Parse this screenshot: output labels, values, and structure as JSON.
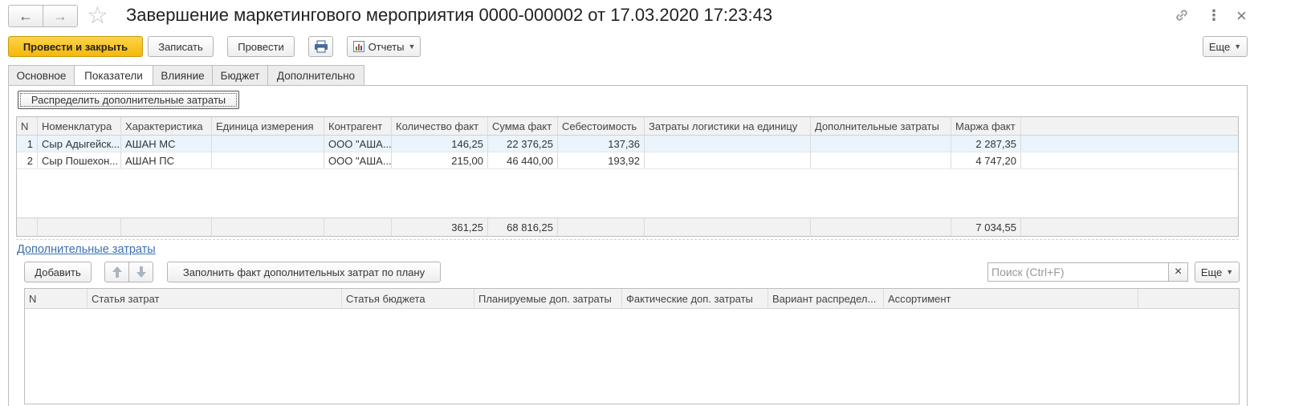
{
  "window": {
    "title": "Завершение маркетингового мероприятия 0000-000002 от 17.03.2020 17:23:43",
    "back_icon": "←",
    "forward_icon": "→",
    "star_icon": "☆",
    "link_icon": "🔗",
    "more_icon": "⋮",
    "close_icon": "×"
  },
  "toolbar": {
    "post_close": "Провести и закрыть",
    "save": "Записать",
    "post": "Провести",
    "reports": "Отчеты",
    "more": "Еще"
  },
  "tabs": [
    {
      "label": "Основное",
      "active": false
    },
    {
      "label": "Показатели",
      "active": true
    },
    {
      "label": "Влияние",
      "active": false
    },
    {
      "label": "Бюджет",
      "active": false
    },
    {
      "label": "Дополнительно",
      "active": false
    }
  ],
  "distribute_button": "Распределить дополнительные затраты",
  "indicators_table": {
    "columns": [
      "N",
      "Номенклатура",
      "Характеристика",
      "Единица измерения",
      "Контрагент",
      "Количество факт",
      "Сумма факт",
      "Себестоимость",
      "Затраты логистики на единицу",
      "Дополнительные затраты",
      "Маржа факт"
    ],
    "rows": [
      [
        "1",
        "Сыр Адыгейск...",
        "АШАН МС",
        "",
        "ООО \"АША...",
        "146,25",
        "22 376,25",
        "137,36",
        "",
        "",
        "2 287,35"
      ],
      [
        "2",
        "Сыр Пошехон...",
        "АШАН ПС",
        "",
        "ООО \"АША...",
        "215,00",
        "46 440,00",
        "193,92",
        "",
        "",
        "4 747,20"
      ]
    ],
    "totals": [
      "",
      "",
      "",
      "",
      "",
      "361,25",
      "68 816,25",
      "",
      "",
      "",
      "7 034,55"
    ]
  },
  "extra_costs": {
    "link_label": "Дополнительные затраты",
    "add_button": "Добавить",
    "fill_button": "Заполнить факт дополнительных затрат по плану",
    "search_placeholder": "Поиск (Ctrl+F)",
    "search_clear": "×",
    "more": "Еще",
    "columns": [
      "N",
      "Статья затрат",
      "Статья бюджета",
      "Планируемые доп. затраты",
      "Фактические доп. затраты",
      "Вариант распредел...",
      "Ассортимент"
    ]
  },
  "colors": {
    "primary": "#f4b80a",
    "link": "#3a6fb0",
    "selected_row": "#eaf4fc"
  }
}
